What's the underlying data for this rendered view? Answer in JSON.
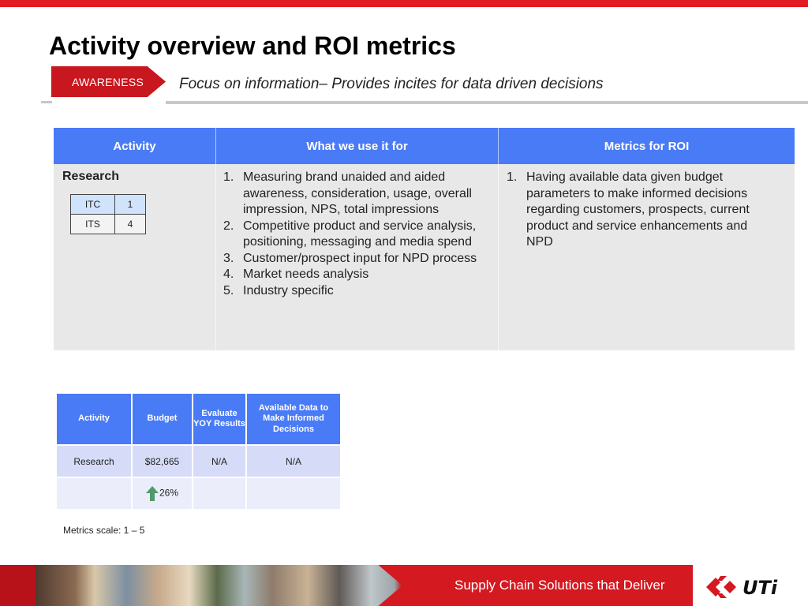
{
  "header": {
    "title": "Activity overview and ROI metrics",
    "badge": "AWARENESS",
    "subtitle": "Focus on information– Provides incites for data driven decisions"
  },
  "main_table": {
    "headers": [
      "Activity",
      "What we use it for",
      "Metrics for ROI"
    ],
    "activity": "Research",
    "mini_table": [
      {
        "label": "ITC",
        "value": "1"
      },
      {
        "label": "ITS",
        "value": "4"
      }
    ],
    "uses": [
      "Measuring brand unaided and aided awareness, consideration, usage, overall impression, NPS, total impressions",
      "Competitive product and service analysis, positioning, messaging and media spend",
      "Customer/prospect input for NPD process",
      "Market needs analysis",
      "Industry specific"
    ],
    "metrics": [
      "Having available data given budget parameters to make informed decisions regarding customers, prospects, current product and service enhancements and NPD"
    ]
  },
  "budget_table": {
    "headers": [
      "Activity",
      "Budget",
      "Evaluate YOY Results",
      "Available Data to Make Informed Decisions"
    ],
    "row1": {
      "activity": "Research",
      "budget": "$82,665",
      "evaluate": "N/A",
      "available": "N/A"
    },
    "row2": {
      "change": "26%",
      "change_icon": "up-arrow-icon"
    }
  },
  "scale_note": "Metrics scale: 1 – 5",
  "footer": {
    "tagline": "Supply Chain Solutions that Deliver",
    "logo_text": "UTi"
  },
  "colors": {
    "brand_red": "#e31b23",
    "table_header_blue": "#4a7bf6",
    "arrow_green": "#4f9a6a"
  }
}
